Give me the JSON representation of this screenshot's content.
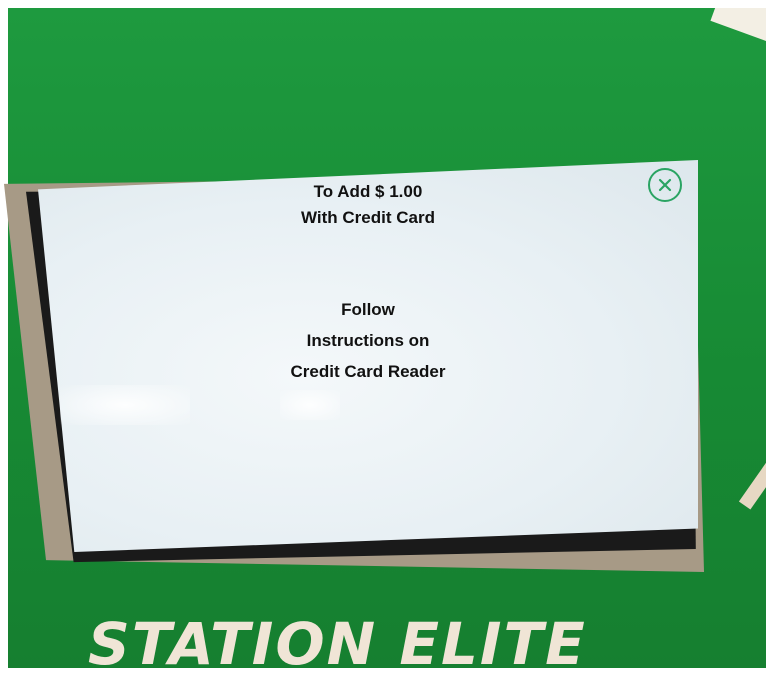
{
  "screen": {
    "line1": "To Add $ 1.00",
    "line2": "With Credit Card",
    "line3": "Follow",
    "line4": "Instructions on",
    "line5": "Credit Card Reader"
  },
  "brand": {
    "logo_text": "STATION ELITE"
  },
  "colors": {
    "kiosk_green": "#1e9a3f",
    "close_accent": "#2aa463",
    "screen_bg": "#e8f0f4"
  },
  "icons": {
    "close": "close-icon"
  }
}
